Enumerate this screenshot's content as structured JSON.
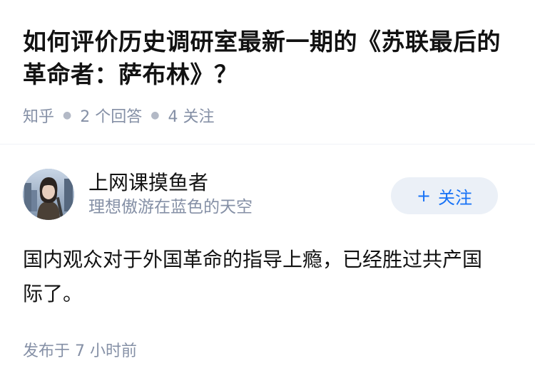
{
  "question": {
    "title": "如何评价历史调研室最新一期的《苏联最后的革命者：萨布林》？",
    "source": "知乎",
    "answers_label": "2 个回答",
    "followers_label": "4 关注"
  },
  "answer": {
    "author": {
      "name": "上网课摸鱼者",
      "bio": "理想傲游在蓝色的天空"
    },
    "follow_button": {
      "icon": "+",
      "label": "关注"
    },
    "content": "国内观众对于外国革命的指导上瘾，已经胜过共产国际了。",
    "time": "发布于 7 小时前"
  },
  "colors": {
    "accent": "#1772f6",
    "follow_bg": "#ebf0f7",
    "meta_text": "#8590a6",
    "main_text": "#121212"
  }
}
